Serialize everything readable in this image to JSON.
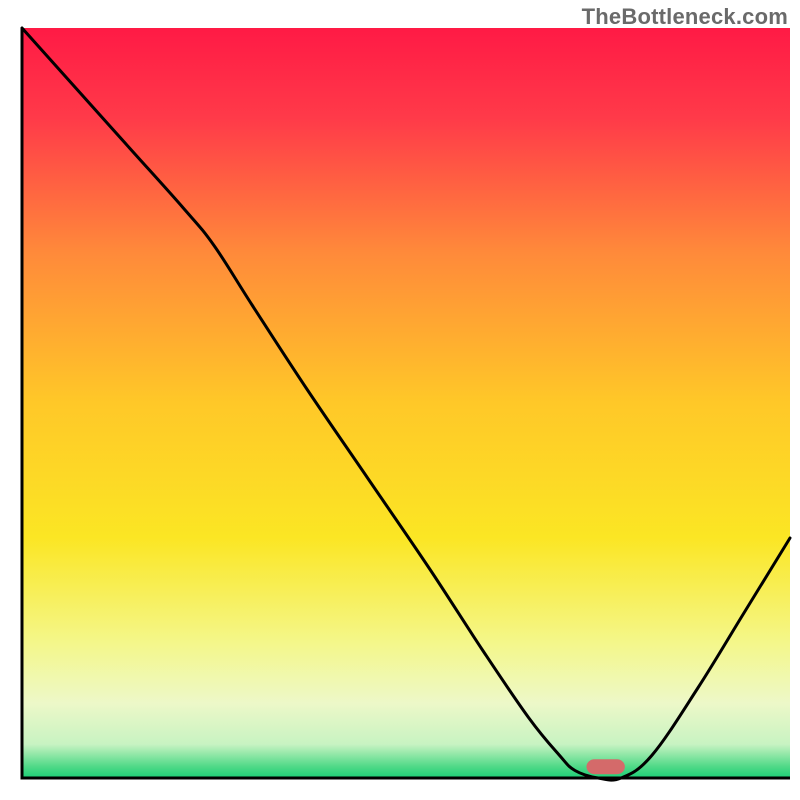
{
  "watermark": "TheBottleneck.com",
  "chart_data": {
    "type": "line",
    "title": "",
    "xlabel": "",
    "ylabel": "",
    "xlim": [
      0,
      100
    ],
    "ylim": [
      0,
      100
    ],
    "grid": false,
    "legend": false,
    "gradient_stops": [
      {
        "offset": 0.0,
        "color": "#ff1a45"
      },
      {
        "offset": 0.12,
        "color": "#ff3a49"
      },
      {
        "offset": 0.3,
        "color": "#ff8a3a"
      },
      {
        "offset": 0.5,
        "color": "#ffc828"
      },
      {
        "offset": 0.68,
        "color": "#fbe624"
      },
      {
        "offset": 0.82,
        "color": "#f4f78a"
      },
      {
        "offset": 0.9,
        "color": "#edf8c8"
      },
      {
        "offset": 0.955,
        "color": "#c8f3c2"
      },
      {
        "offset": 0.985,
        "color": "#4fd987"
      },
      {
        "offset": 1.0,
        "color": "#1ccf77"
      }
    ],
    "series": [
      {
        "name": "bottleneck-curve",
        "color": "#000000",
        "x": [
          0,
          7,
          14,
          21,
          25,
          30,
          37,
          45,
          53,
          60,
          66,
          70,
          72,
          75,
          78,
          82,
          88,
          94,
          100
        ],
        "y": [
          100,
          92,
          84,
          76,
          71,
          63,
          52,
          40,
          28,
          17,
          8,
          3,
          1,
          0,
          0,
          3,
          12,
          22,
          32
        ]
      }
    ],
    "marker": {
      "name": "optimal-point",
      "x": 76,
      "y": 1.5,
      "color": "#d46a6a",
      "width": 5,
      "height": 2
    }
  }
}
